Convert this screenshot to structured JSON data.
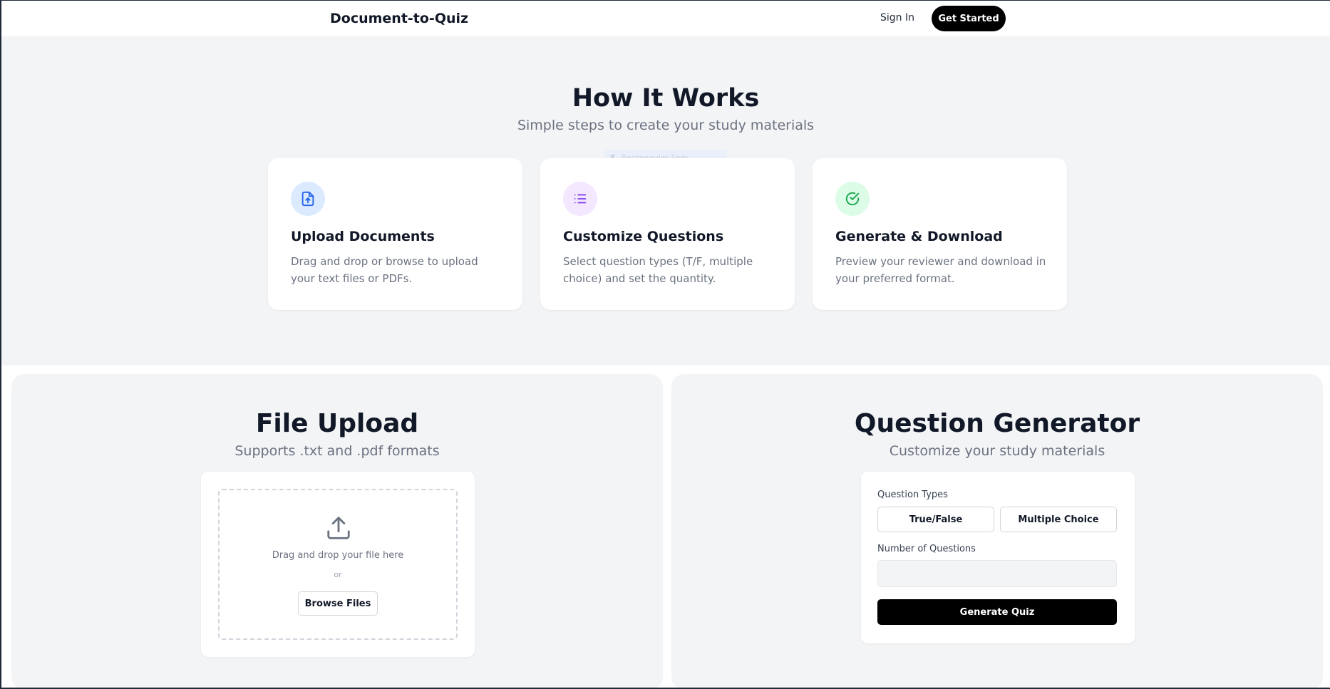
{
  "nav": {
    "brand": "Document-to-Quiz",
    "sign_in": "Sign In",
    "get_started": "Get Started"
  },
  "how": {
    "title": "How It Works",
    "subtitle": "Simple steps to create your study materials",
    "ghost_label": "Rectangular Snip",
    "cards": [
      {
        "icon": "file-upload-icon",
        "icon_color": "#2563eb",
        "icon_bg": "#dbeafe",
        "title": "Upload Documents",
        "text": "Drag and drop or browse to upload your text files or PDFs."
      },
      {
        "icon": "list-icon",
        "icon_color": "#7c3aed",
        "icon_bg": "#f3e8ff",
        "title": "Customize Questions",
        "text": "Select question types (T/F, multiple choice) and set the quantity."
      },
      {
        "icon": "check-circle-icon",
        "icon_color": "#16a34a",
        "icon_bg": "#dcfce7",
        "title": "Generate & Download",
        "text": "Preview your reviewer and download in your preferred format."
      }
    ]
  },
  "upload": {
    "title": "File Upload",
    "subtitle": "Supports .txt and .pdf formats",
    "drop_text": "Drag and drop your file here",
    "or": "or",
    "browse": "Browse Files"
  },
  "generator": {
    "title": "Question Generator",
    "subtitle": "Customize your study materials",
    "types_label": "Question Types",
    "type_tf": "True/False",
    "type_mc": "Multiple Choice",
    "number_label": "Number of Questions",
    "number_value": "",
    "generate": "Generate Quiz"
  }
}
